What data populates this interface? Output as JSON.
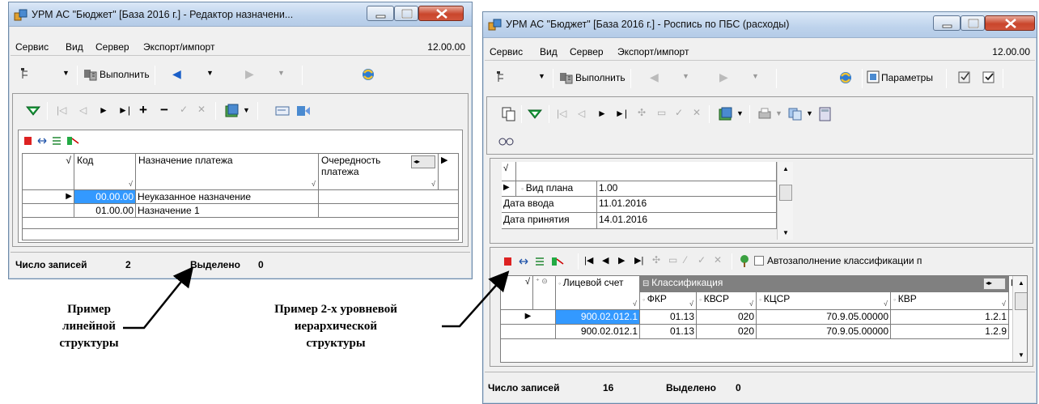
{
  "left_window": {
    "title": "УРМ АС \"Бюджет\" [База 2016 г.] - Редактор назначени...",
    "menu": [
      "Сервис",
      "Вид",
      "Сервер",
      "Экспорт/импорт"
    ],
    "version": "12.00.00",
    "run_label": "Выполнить",
    "grid": {
      "columns": [
        "Код",
        "Назначение платежа",
        "Очередность платежа"
      ],
      "rows": [
        {
          "code": "00.00.00",
          "name": "Неуказанное назначение",
          "order": ""
        },
        {
          "code": "01.00.00",
          "name": "Назначение 1",
          "order": ""
        }
      ]
    },
    "status": {
      "records_label": "Число записей",
      "records": "2",
      "selected_label": "Выделено",
      "selected": "0"
    }
  },
  "right_window": {
    "title": "УРМ АС \"Бюджет\" [База 2016 г.] - Роспись по ПБС (расходы)",
    "menu": [
      "Сервис",
      "Вид",
      "Сервер",
      "Экспорт/импорт"
    ],
    "version": "12.00.00",
    "run_label": "Выполнить",
    "params_label": "Параметры",
    "header_form": {
      "rows": [
        {
          "label": "Вид плана",
          "value": "1.00"
        },
        {
          "label": "Дата ввода",
          "value": "11.01.2016"
        },
        {
          "label": "Дата принятия",
          "value": "14.01.2016"
        }
      ]
    },
    "autofill_label": "Автозаполнение классификации п",
    "grid": {
      "account_col": "Лицевой счет",
      "group_col": "Классификация",
      "sub_cols": [
        "ФКР",
        "КВСР",
        "КЦСР",
        "КВР"
      ],
      "rows": [
        {
          "account": "900.02.012.1",
          "fkr": "01.13",
          "kvsr": "020",
          "kcsr": "70.9.05.00000",
          "kvr": "1.2.1"
        },
        {
          "account": "900.02.012.1",
          "fkr": "01.13",
          "kvsr": "020",
          "kcsr": "70.9.05.00000",
          "kvr": "1.2.9"
        }
      ]
    },
    "status": {
      "records_label": "Число записей",
      "records": "16",
      "selected_label": "Выделено",
      "selected": "0"
    }
  },
  "captions": {
    "linear_1": "Пример",
    "linear_2": "линейной",
    "linear_3": "структуры",
    "hier_1": "Пример 2-х уровневой",
    "hier_2": "иерархической",
    "hier_3": "структуры"
  },
  "colors": {
    "selection": "#3399ff",
    "group_header": "#808080",
    "close_button": "#c9462c"
  }
}
